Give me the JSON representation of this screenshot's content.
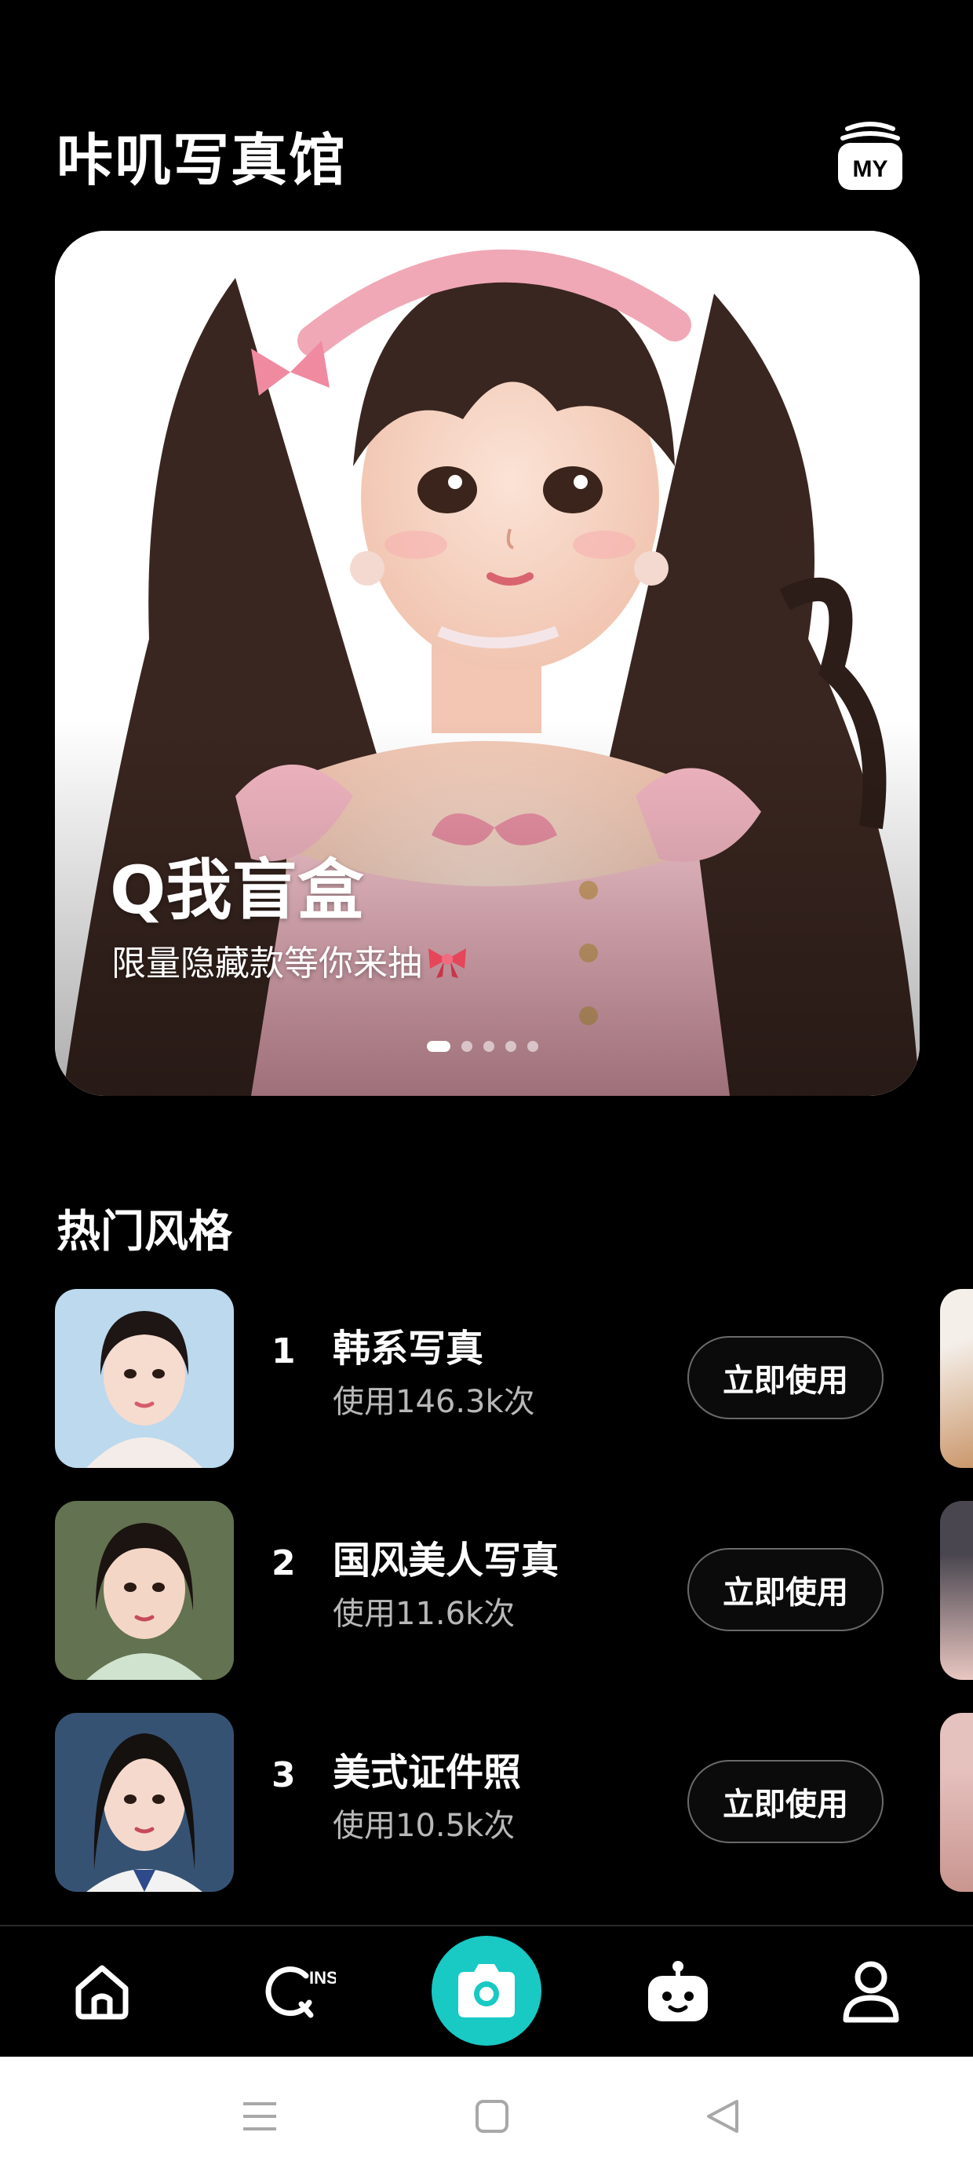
{
  "header": {
    "title": "咔叽写真馆",
    "my_label": "MY"
  },
  "hero": {
    "title": "Q我盲盒",
    "subtitle": "限量隐藏款等你来抽",
    "slide_count": 5,
    "active_slide": 1
  },
  "section": {
    "title": "热门风格"
  },
  "styles": [
    {
      "rank": "1",
      "name": "韩系写真",
      "usage": "使用146.3k次",
      "button": "立即使用"
    },
    {
      "rank": "2",
      "name": "国风美人写真",
      "usage": "使用11.6k次",
      "button": "立即使用"
    },
    {
      "rank": "3",
      "name": "美式证件照",
      "usage": "使用10.5k次",
      "button": "立即使用"
    }
  ],
  "nav": {
    "items": [
      "home-icon",
      "ins-search-icon",
      "camera-icon",
      "robot-icon",
      "profile-icon"
    ],
    "ins_label": "INS"
  },
  "colors": {
    "background": "#000000",
    "accent": "#18c9c4",
    "hero_bg": "#ffffff",
    "bow_pink": "#f08aa0"
  }
}
